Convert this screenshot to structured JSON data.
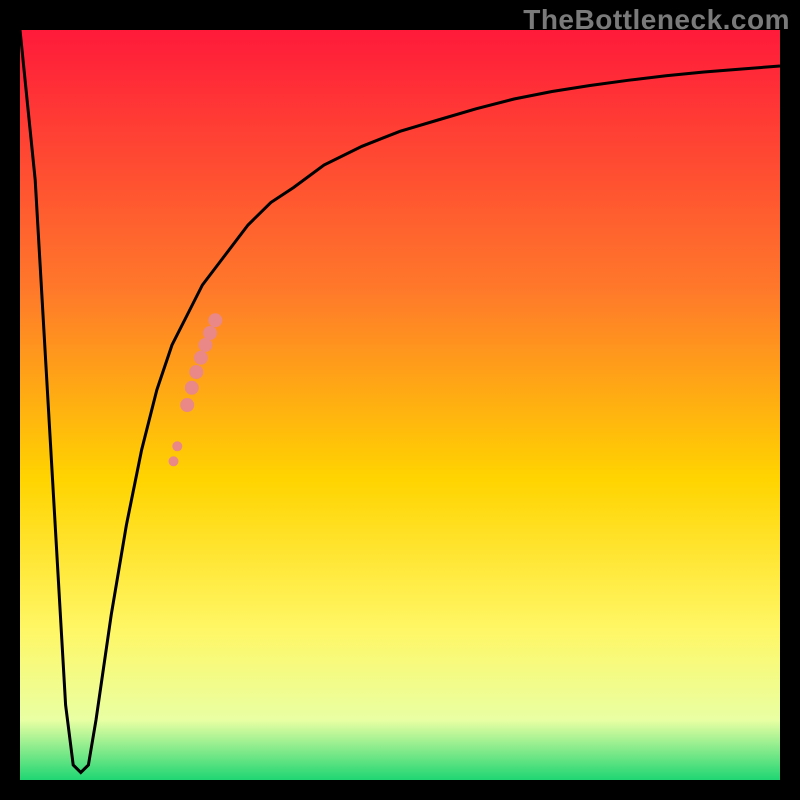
{
  "watermark": "TheBottleneck.com",
  "colors": {
    "frame": "#000000",
    "curve": "#000000",
    "markers": "#e98886",
    "gradient_top": "#ff1a3a",
    "gradient_mid1": "#ff7a2a",
    "gradient_mid2": "#ffd400",
    "gradient_mid3": "#fff766",
    "gradient_mid4": "#e9ffa3",
    "gradient_bottom": "#1fd673"
  },
  "chart_data": {
    "type": "line",
    "title": "",
    "xlabel": "",
    "ylabel": "",
    "xlim": [
      0,
      100
    ],
    "ylim": [
      0,
      100
    ],
    "curve": {
      "x": [
        0,
        2,
        4,
        6,
        7,
        8,
        9,
        10,
        11,
        12,
        14,
        16,
        18,
        20,
        22,
        24,
        27,
        30,
        33,
        36,
        40,
        45,
        50,
        55,
        60,
        65,
        70,
        75,
        80,
        85,
        90,
        95,
        100
      ],
      "y": [
        100,
        80,
        45,
        10,
        2,
        1,
        2,
        8,
        15,
        22,
        34,
        44,
        52,
        58,
        62,
        66,
        70,
        74,
        77,
        79,
        82,
        84.5,
        86.5,
        88,
        89.5,
        90.8,
        91.8,
        92.6,
        93.3,
        93.9,
        94.4,
        94.8,
        95.2
      ]
    },
    "markers": [
      {
        "x": 20.2,
        "y": 42.5,
        "r": 5
      },
      {
        "x": 20.7,
        "y": 44.5,
        "r": 5
      },
      {
        "x": 22.0,
        "y": 50.0,
        "r": 7
      },
      {
        "x": 22.6,
        "y": 52.3,
        "r": 7
      },
      {
        "x": 23.2,
        "y": 54.4,
        "r": 7
      },
      {
        "x": 23.8,
        "y": 56.3,
        "r": 7
      },
      {
        "x": 24.4,
        "y": 58.0,
        "r": 7
      },
      {
        "x": 25.0,
        "y": 59.6,
        "r": 7
      },
      {
        "x": 25.7,
        "y": 61.3,
        "r": 7
      }
    ]
  }
}
